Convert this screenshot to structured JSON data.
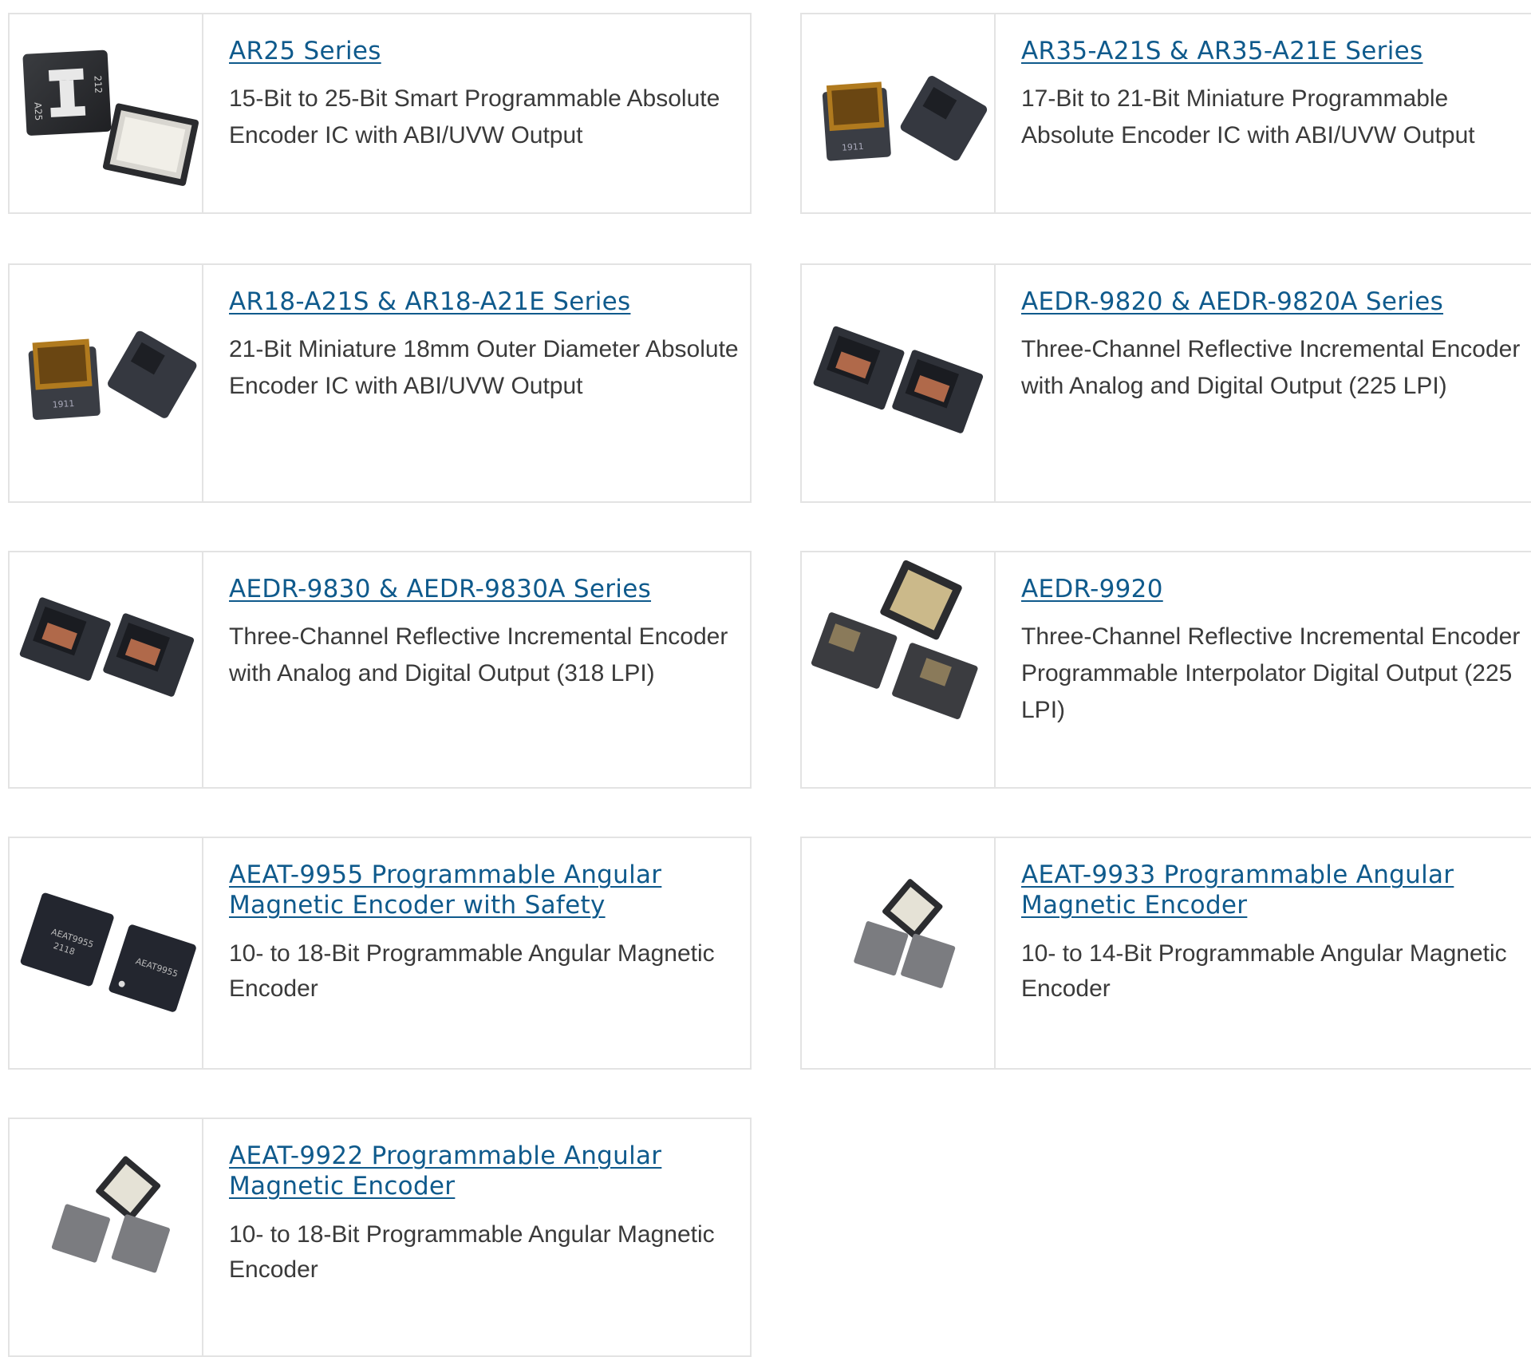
{
  "products": [
    {
      "title": "AR25 Series",
      "description": "15-Bit to 25-Bit Smart Programmable Absolute Encoder IC with ABI/UVW Output",
      "image": "ar25-chip-image"
    },
    {
      "title": "AR35-A21S & AR35-A21E Series",
      "description": "17-Bit to 21-Bit Miniature Programmable Absolute Encoder IC with ABI/UVW Output",
      "image": "ar35-chip-image"
    },
    {
      "title": "AR18-A21S & AR18-A21E Series",
      "description": "21-Bit Miniature 18mm Outer Diameter Absolute Encoder IC with ABI/UVW Output",
      "image": "ar18-chip-image"
    },
    {
      "title": "AEDR-9820 & AEDR-9820A Series",
      "description": "Three-Channel Reflective Incremental Encoder with Analog and Digital Output (225 LPI)",
      "image": "aedr-9820-chip-image"
    },
    {
      "title": "AEDR-9830 & AEDR-9830A Series",
      "description": "Three-Channel Reflective Incremental Encoder with Analog and Digital Output (318 LPI)",
      "image": "aedr-9830-chip-image"
    },
    {
      "title": "AEDR-9920",
      "description": "Three-Channel Reflective Incremental Encoder Programmable Interpolator Digital Output (225 LPI)",
      "image": "aedr-9920-chip-image"
    },
    {
      "title": "AEAT-9955 Programmable Angular Magnetic Encoder with Safety",
      "description": "10- to 18-Bit Programmable Angular Magnetic Encoder",
      "image": "aeat-9955-chip-image"
    },
    {
      "title": "AEAT-9933 Programmable Angular Magnetic Encoder",
      "description": "10- to 14-Bit Programmable Angular Magnetic Encoder",
      "image": "aeat-9933-chip-image"
    },
    {
      "title": "AEAT-9922 Programmable Angular Magnetic Encoder",
      "description": "10- to 18-Bit Programmable Angular Magnetic Encoder",
      "image": "aeat-9922-chip-image"
    }
  ],
  "colors": {
    "link": "#0f5a8c",
    "text": "#3a3a3a",
    "border": "#e3e3e3"
  }
}
